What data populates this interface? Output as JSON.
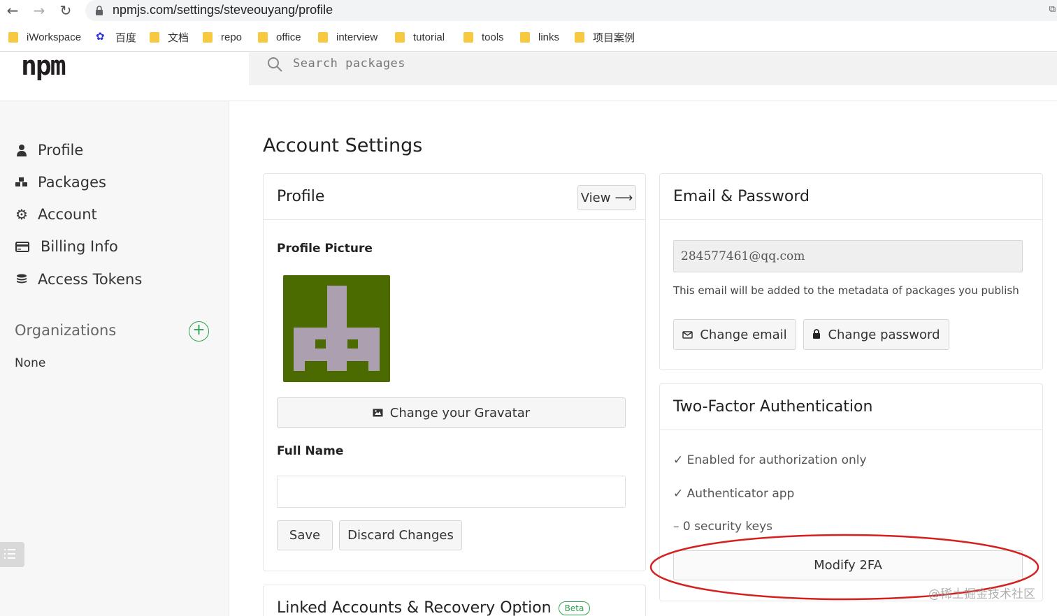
{
  "browser": {
    "url": "npmjs.com/settings/steveouyang/profile",
    "bookmarks": [
      "iWorkspace",
      "百度",
      "文档",
      "repo",
      "office",
      "interview",
      "tutorial",
      "tools",
      "links",
      "项目案例"
    ]
  },
  "header": {
    "logo": "npm",
    "search_placeholder": "Search packages"
  },
  "sidebar": {
    "items": [
      {
        "label": "Profile",
        "icon": "user-icon"
      },
      {
        "label": "Packages",
        "icon": "cubes-icon"
      },
      {
        "label": "Account",
        "icon": "gear-icon"
      },
      {
        "label": "Billing Info",
        "icon": "credit-card-icon"
      },
      {
        "label": "Access Tokens",
        "icon": "database-icon"
      }
    ],
    "organizations_title": "Organizations",
    "organizations_value": "None"
  },
  "main": {
    "title": "Account Settings",
    "profile_card": {
      "title": "Profile",
      "view_label": "View",
      "picture_label": "Profile Picture",
      "gravatar_button": "Change your Gravatar",
      "full_name_label": "Full Name",
      "full_name_value": "",
      "save_label": "Save",
      "discard_label": "Discard Changes"
    },
    "linked_card": {
      "title": "Linked Accounts & Recovery Option",
      "badge": "Beta"
    },
    "email_card": {
      "title": "Email & Password",
      "email_value": "284577461@qq.com",
      "note": "This email will be added to the metadata of packages you publish",
      "change_email": "Change email",
      "change_password": "Change password"
    },
    "tfa_card": {
      "title": "Two-Factor Authentication",
      "lines": [
        "✓ Enabled for authorization only",
        "✓ Authenticator app",
        "– 0 security keys"
      ],
      "modify_label": "Modify 2FA"
    }
  },
  "watermark": "@稀土掘金技术社区",
  "colors": {
    "avatar_bg": "#4b6b00",
    "avatar_fg": "#ab9fb0",
    "annotation": "#d62020",
    "accent_green": "#2ea44f"
  }
}
